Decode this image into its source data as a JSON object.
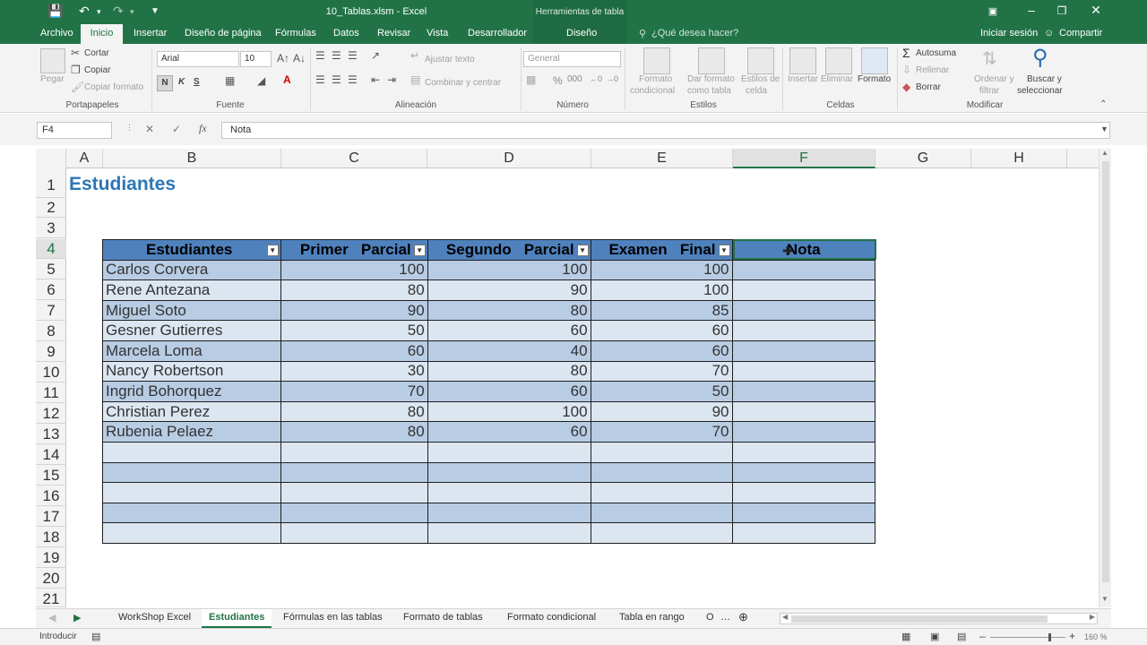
{
  "title_bar": {
    "document_title": "10_Tablas.xlsm - Excel",
    "context_title": "Herramientas de tabla"
  },
  "tabs": {
    "archivo": "Archivo",
    "inicio": "Inicio",
    "insertar": "Insertar",
    "diseno_pagina": "Diseño de página",
    "formulas": "Fórmulas",
    "datos": "Datos",
    "revisar": "Revisar",
    "vista": "Vista",
    "desarrollador": "Desarrollador",
    "diseno": "Diseño",
    "tell_me": "¿Qué desea hacer?",
    "sign_in": "Iniciar sesión",
    "share": "Compartir"
  },
  "ribbon": {
    "pegar": "Pegar",
    "cortar": "Cortar",
    "copiar": "Copiar",
    "copiar_formato": "Copiar formato",
    "portapapeles": "Portapapeles",
    "font_name": "Arial",
    "font_size": "10",
    "bold": "N",
    "italic": "K",
    "underline": "S",
    "fuente": "Fuente",
    "ajustar_texto": "Ajustar texto",
    "combinar": "Combinar y centrar",
    "alineacion": "Alineación",
    "number_format": "General",
    "numero": "Número",
    "formato_condicional_1": "Formato",
    "formato_condicional_2": "condicional",
    "dar_formato_1": "Dar formato",
    "dar_formato_2": "como tabla",
    "estilos_celda_1": "Estilos de",
    "estilos_celda_2": "celda",
    "estilos": "Estilos",
    "insertar": "Insertar",
    "eliminar": "Eliminar",
    "formato": "Formato",
    "celdas": "Celdas",
    "autosuma": "Autosuma",
    "rellenar": "Rellenar",
    "borrar": "Borrar",
    "ordenar_1": "Ordenar y",
    "ordenar_2": "filtrar",
    "buscar_1": "Buscar y",
    "buscar_2": "seleccionar",
    "modificar": "Modificar"
  },
  "formula_bar": {
    "name_box": "F4",
    "formula": "Nota"
  },
  "columns": [
    "A",
    "B",
    "C",
    "D",
    "E",
    "F",
    "G",
    "H"
  ],
  "rows": [
    "1",
    "2",
    "3",
    "4",
    "5",
    "6",
    "7",
    "8",
    "9",
    "10",
    "11",
    "12",
    "13",
    "14",
    "15",
    "16",
    "17",
    "18",
    "19",
    "20",
    "21"
  ],
  "sheet": {
    "title": "Estudiantes",
    "table": {
      "headers": [
        "Estudiantes",
        "Primer   Parcial",
        "Segundo   Parcial",
        "Examen   Final",
        "Nota"
      ],
      "rows": [
        [
          "Carlos Corvera",
          "100",
          "100",
          "100",
          ""
        ],
        [
          "Rene Antezana",
          "80",
          "90",
          "100",
          ""
        ],
        [
          "Miguel Soto",
          "90",
          "80",
          "85",
          ""
        ],
        [
          "Gesner Gutierres",
          "50",
          "60",
          "60",
          ""
        ],
        [
          "Marcela Loma",
          "60",
          "40",
          "60",
          ""
        ],
        [
          "Nancy Robertson",
          "30",
          "80",
          "70",
          ""
        ],
        [
          "Ingrid Bohorquez",
          "70",
          "60",
          "50",
          ""
        ],
        [
          "Christian Perez",
          "80",
          "100",
          "90",
          ""
        ],
        [
          "Rubenia Pelaez",
          "80",
          "60",
          "70",
          ""
        ],
        [
          "",
          "",
          "",
          "",
          ""
        ],
        [
          "",
          "",
          "",
          "",
          ""
        ],
        [
          "",
          "",
          "",
          "",
          ""
        ],
        [
          "",
          "",
          "",
          "",
          ""
        ],
        [
          "",
          "",
          "",
          "",
          ""
        ]
      ]
    }
  },
  "sheet_tabs": [
    "WorkShop Excel",
    "Estudiantes",
    "Fórmulas en las tablas",
    "Formato de tablas",
    "Formato condicional",
    "Tabla en rango",
    "O"
  ],
  "active_sheet": "Estudiantes",
  "status": {
    "mode": "Introducir",
    "zoom": "160 %"
  },
  "colors": {
    "excel_green": "#217346",
    "header_blue": "#4f81bd",
    "band_dark": "#b8cce4",
    "band_light": "#dce6f1",
    "title_blue": "#2e75b6"
  }
}
